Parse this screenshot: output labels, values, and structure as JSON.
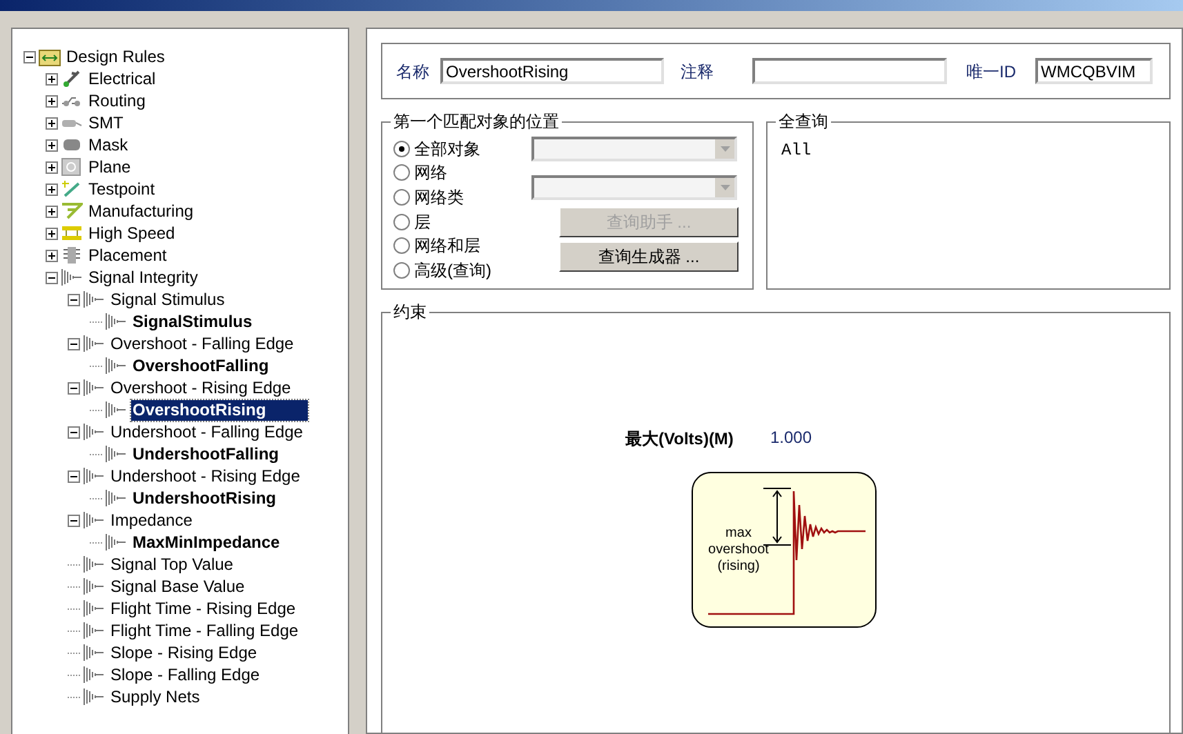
{
  "tree": [
    {
      "label": "Design Rules",
      "kind": "group",
      "expanded": true,
      "selected": false,
      "children": [
        {
          "label": "Electrical",
          "kind": "group",
          "expanded": false,
          "selected": false
        },
        {
          "label": "Routing",
          "kind": "group",
          "expanded": false,
          "selected": false
        },
        {
          "label": "SMT",
          "kind": "group",
          "expanded": false,
          "selected": false
        },
        {
          "label": "Mask",
          "kind": "group",
          "expanded": false,
          "selected": false
        },
        {
          "label": "Plane",
          "kind": "group",
          "expanded": false,
          "selected": false
        },
        {
          "label": "Testpoint",
          "kind": "group",
          "expanded": false,
          "selected": false
        },
        {
          "label": "Manufacturing",
          "kind": "group",
          "expanded": false,
          "selected": false
        },
        {
          "label": "High Speed",
          "kind": "group",
          "expanded": false,
          "selected": false
        },
        {
          "label": "Placement",
          "kind": "group",
          "expanded": false,
          "selected": false
        },
        {
          "label": "Signal Integrity",
          "kind": "group",
          "expanded": true,
          "selected": false,
          "children": [
            {
              "label": "Signal Stimulus",
              "kind": "group",
              "expanded": true,
              "selected": false,
              "children": [
                {
                  "label": "SignalStimulus",
                  "kind": "rule",
                  "selected": false
                }
              ]
            },
            {
              "label": "Overshoot - Falling Edge",
              "kind": "group",
              "expanded": true,
              "selected": false,
              "children": [
                {
                  "label": "OvershootFalling",
                  "kind": "rule",
                  "selected": false
                }
              ]
            },
            {
              "label": "Overshoot - Rising Edge",
              "kind": "group",
              "expanded": true,
              "selected": false,
              "children": [
                {
                  "label": "OvershootRising",
                  "kind": "rule",
                  "selected": true
                }
              ]
            },
            {
              "label": "Undershoot - Falling Edge",
              "kind": "group",
              "expanded": true,
              "selected": false,
              "children": [
                {
                  "label": "UndershootFalling",
                  "kind": "rule",
                  "selected": false
                }
              ]
            },
            {
              "label": "Undershoot - Rising Edge",
              "kind": "group",
              "expanded": true,
              "selected": false,
              "children": [
                {
                  "label": "UndershootRising",
                  "kind": "rule",
                  "selected": false
                }
              ]
            },
            {
              "label": "Impedance",
              "kind": "group",
              "expanded": true,
              "selected": false,
              "children": [
                {
                  "label": "MaxMinImpedance",
                  "kind": "rule",
                  "selected": false
                }
              ]
            },
            {
              "label": "Signal Top Value",
              "kind": "type",
              "selected": false
            },
            {
              "label": "Signal Base Value",
              "kind": "type",
              "selected": false
            },
            {
              "label": "Flight Time - Rising Edge",
              "kind": "type",
              "selected": false
            },
            {
              "label": "Flight Time - Falling Edge",
              "kind": "type",
              "selected": false
            },
            {
              "label": "Slope - Rising Edge",
              "kind": "type",
              "selected": false
            },
            {
              "label": "Slope - Falling Edge",
              "kind": "type",
              "selected": false
            },
            {
              "label": "Supply Nets",
              "kind": "type",
              "selected": false
            }
          ]
        }
      ]
    }
  ],
  "header": {
    "name_label": "名称",
    "name_value": "OvershootRising",
    "comment_label": "注释",
    "id_label": "唯一ID",
    "id_value": "WMCQBVIM"
  },
  "scope": {
    "title": "第一个匹配对象的位置",
    "options": [
      {
        "label": "全部对象",
        "selected": true
      },
      {
        "label": "网络",
        "selected": false
      },
      {
        "label": "网络类",
        "selected": false
      },
      {
        "label": "层",
        "selected": false
      },
      {
        "label": "网络和层",
        "selected": false
      },
      {
        "label": "高级(查询)",
        "selected": false
      }
    ],
    "buttons": [
      {
        "label": "查询助手 ...",
        "disabled": true
      },
      {
        "label": "查询生成器 ...",
        "disabled": false
      }
    ]
  },
  "full_query": {
    "title": "全查询",
    "text": "All"
  },
  "constraints": {
    "title": "约束",
    "field_label": "最大(Volts)(M)",
    "field_value": "1.000",
    "diagram_labels": [
      "max",
      "overshoot",
      "(rising)"
    ]
  }
}
